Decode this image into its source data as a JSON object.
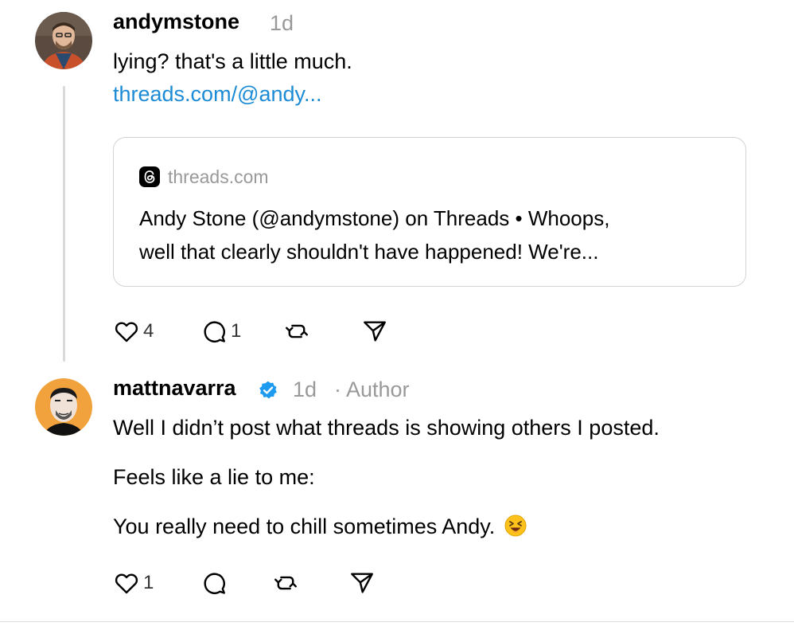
{
  "post1": {
    "username": "andymstone",
    "time": "1d",
    "text": "lying? that's a little much.",
    "link": "threads.com/@andy...",
    "card": {
      "domain": "threads.com",
      "title_line1": "Andy Stone (@andymstone) on Threads • Whoops,",
      "title_line2": "well that clearly shouldn't have happened! We're..."
    },
    "likes": "4",
    "replies": "1"
  },
  "post2": {
    "username": "mattnavarra",
    "time": "1d",
    "author_tag": "· Author",
    "paragraphs": [
      "Well I didn’t post what threads is showing others I posted.",
      "Feels like a lie to me:",
      "You really need to chill sometimes Andy."
    ],
    "likes": "1"
  },
  "colors": {
    "link": "#1c8bd6",
    "verified": "#1d9bf0",
    "muted": "#999999",
    "avatar_bg_orange": "#f2a23c"
  }
}
